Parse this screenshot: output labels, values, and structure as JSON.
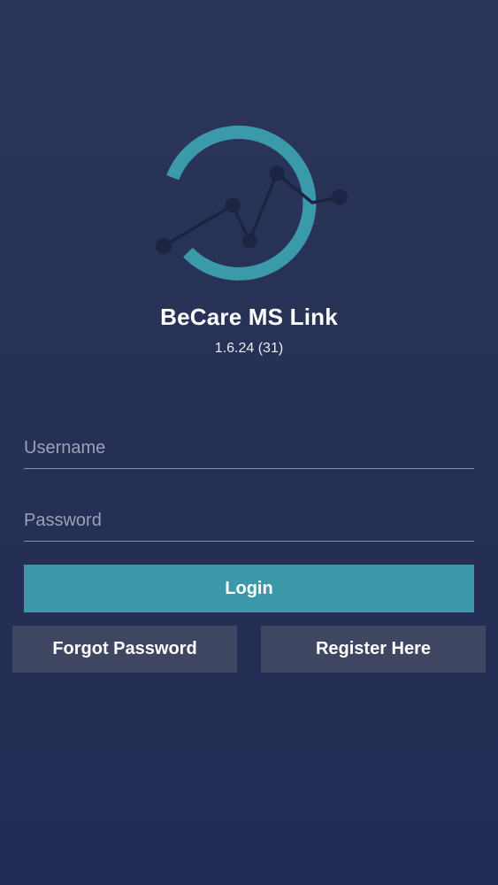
{
  "app": {
    "name": "BeCare MS Link",
    "version": "1.6.24 (31)"
  },
  "logo": {
    "icon": "becare-logo-icon",
    "colors": {
      "ring": "#3a9aa9",
      "line": "#1b2542"
    }
  },
  "form": {
    "username_placeholder": "Username",
    "password_placeholder": "Password"
  },
  "buttons": {
    "login": "Login",
    "forgot_password": "Forgot Password",
    "register": "Register Here"
  },
  "colors": {
    "background": "#263055",
    "accent": "#3a98a8",
    "secondary_button": "#3f4661"
  }
}
